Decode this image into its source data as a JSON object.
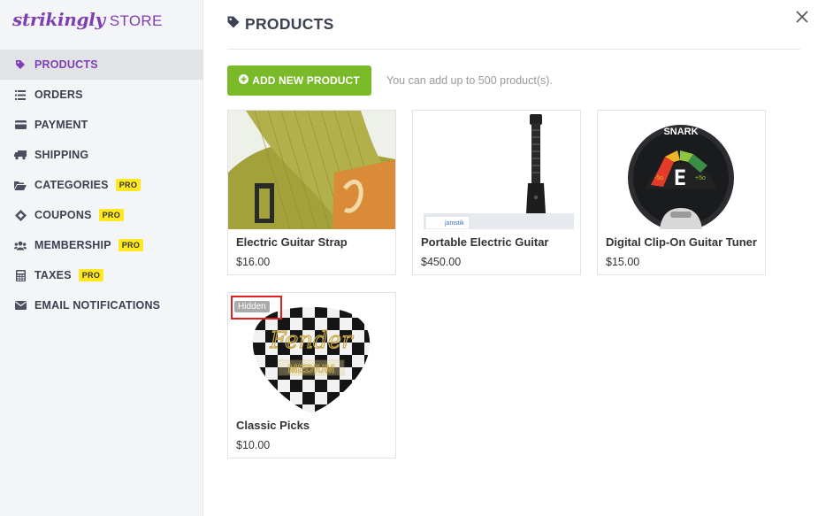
{
  "brand": {
    "logo": "strikingly",
    "store": "STORE"
  },
  "nav": [
    {
      "label": "PRODUCTS",
      "icon": "tag-icon",
      "active": true,
      "pro": false
    },
    {
      "label": "ORDERS",
      "icon": "list-icon",
      "active": false,
      "pro": false
    },
    {
      "label": "PAYMENT",
      "icon": "credit-card-icon",
      "active": false,
      "pro": false
    },
    {
      "label": "SHIPPING",
      "icon": "truck-icon",
      "active": false,
      "pro": false
    },
    {
      "label": "CATEGORIES",
      "icon": "folder-open-icon",
      "active": false,
      "pro": true
    },
    {
      "label": "COUPONS",
      "icon": "ticket-icon",
      "active": false,
      "pro": true
    },
    {
      "label": "MEMBERSHIP",
      "icon": "users-icon",
      "active": false,
      "pro": true
    },
    {
      "label": "TAXES",
      "icon": "calculator-icon",
      "active": false,
      "pro": true
    },
    {
      "label": "EMAIL NOTIFICATIONS",
      "icon": "envelope-icon",
      "active": false,
      "pro": false
    }
  ],
  "pro_badge": "PRO",
  "main": {
    "title": "PRODUCTS",
    "add_button": "ADD NEW PRODUCT",
    "limit_note": "You can add up to 500 product(s)."
  },
  "products": [
    {
      "name": "Electric Guitar Strap",
      "price": "$16.00",
      "hidden": false
    },
    {
      "name": "Portable Electric Guitar",
      "price": "$450.00",
      "hidden": false
    },
    {
      "name": "Digital Clip-On Guitar Tuner",
      "price": "$15.00",
      "hidden": false
    },
    {
      "name": "Classic Picks",
      "price": "$10.00",
      "hidden": true
    }
  ],
  "hidden_badge": "Hidden",
  "image_text": {
    "tuner_brand": "SNARK",
    "tuner_note": "E",
    "tuner_left": "-5o",
    "tuner_right": "+5o",
    "pick_brand": "Fender",
    "pick_weight": "MEDIUM",
    "guitar_box": "jamstik"
  },
  "colors": {
    "brand_purple": "#7e3fb5",
    "add_green": "#7ab928",
    "pro_yellow": "#ffe820",
    "highlight_red": "#e12020"
  }
}
